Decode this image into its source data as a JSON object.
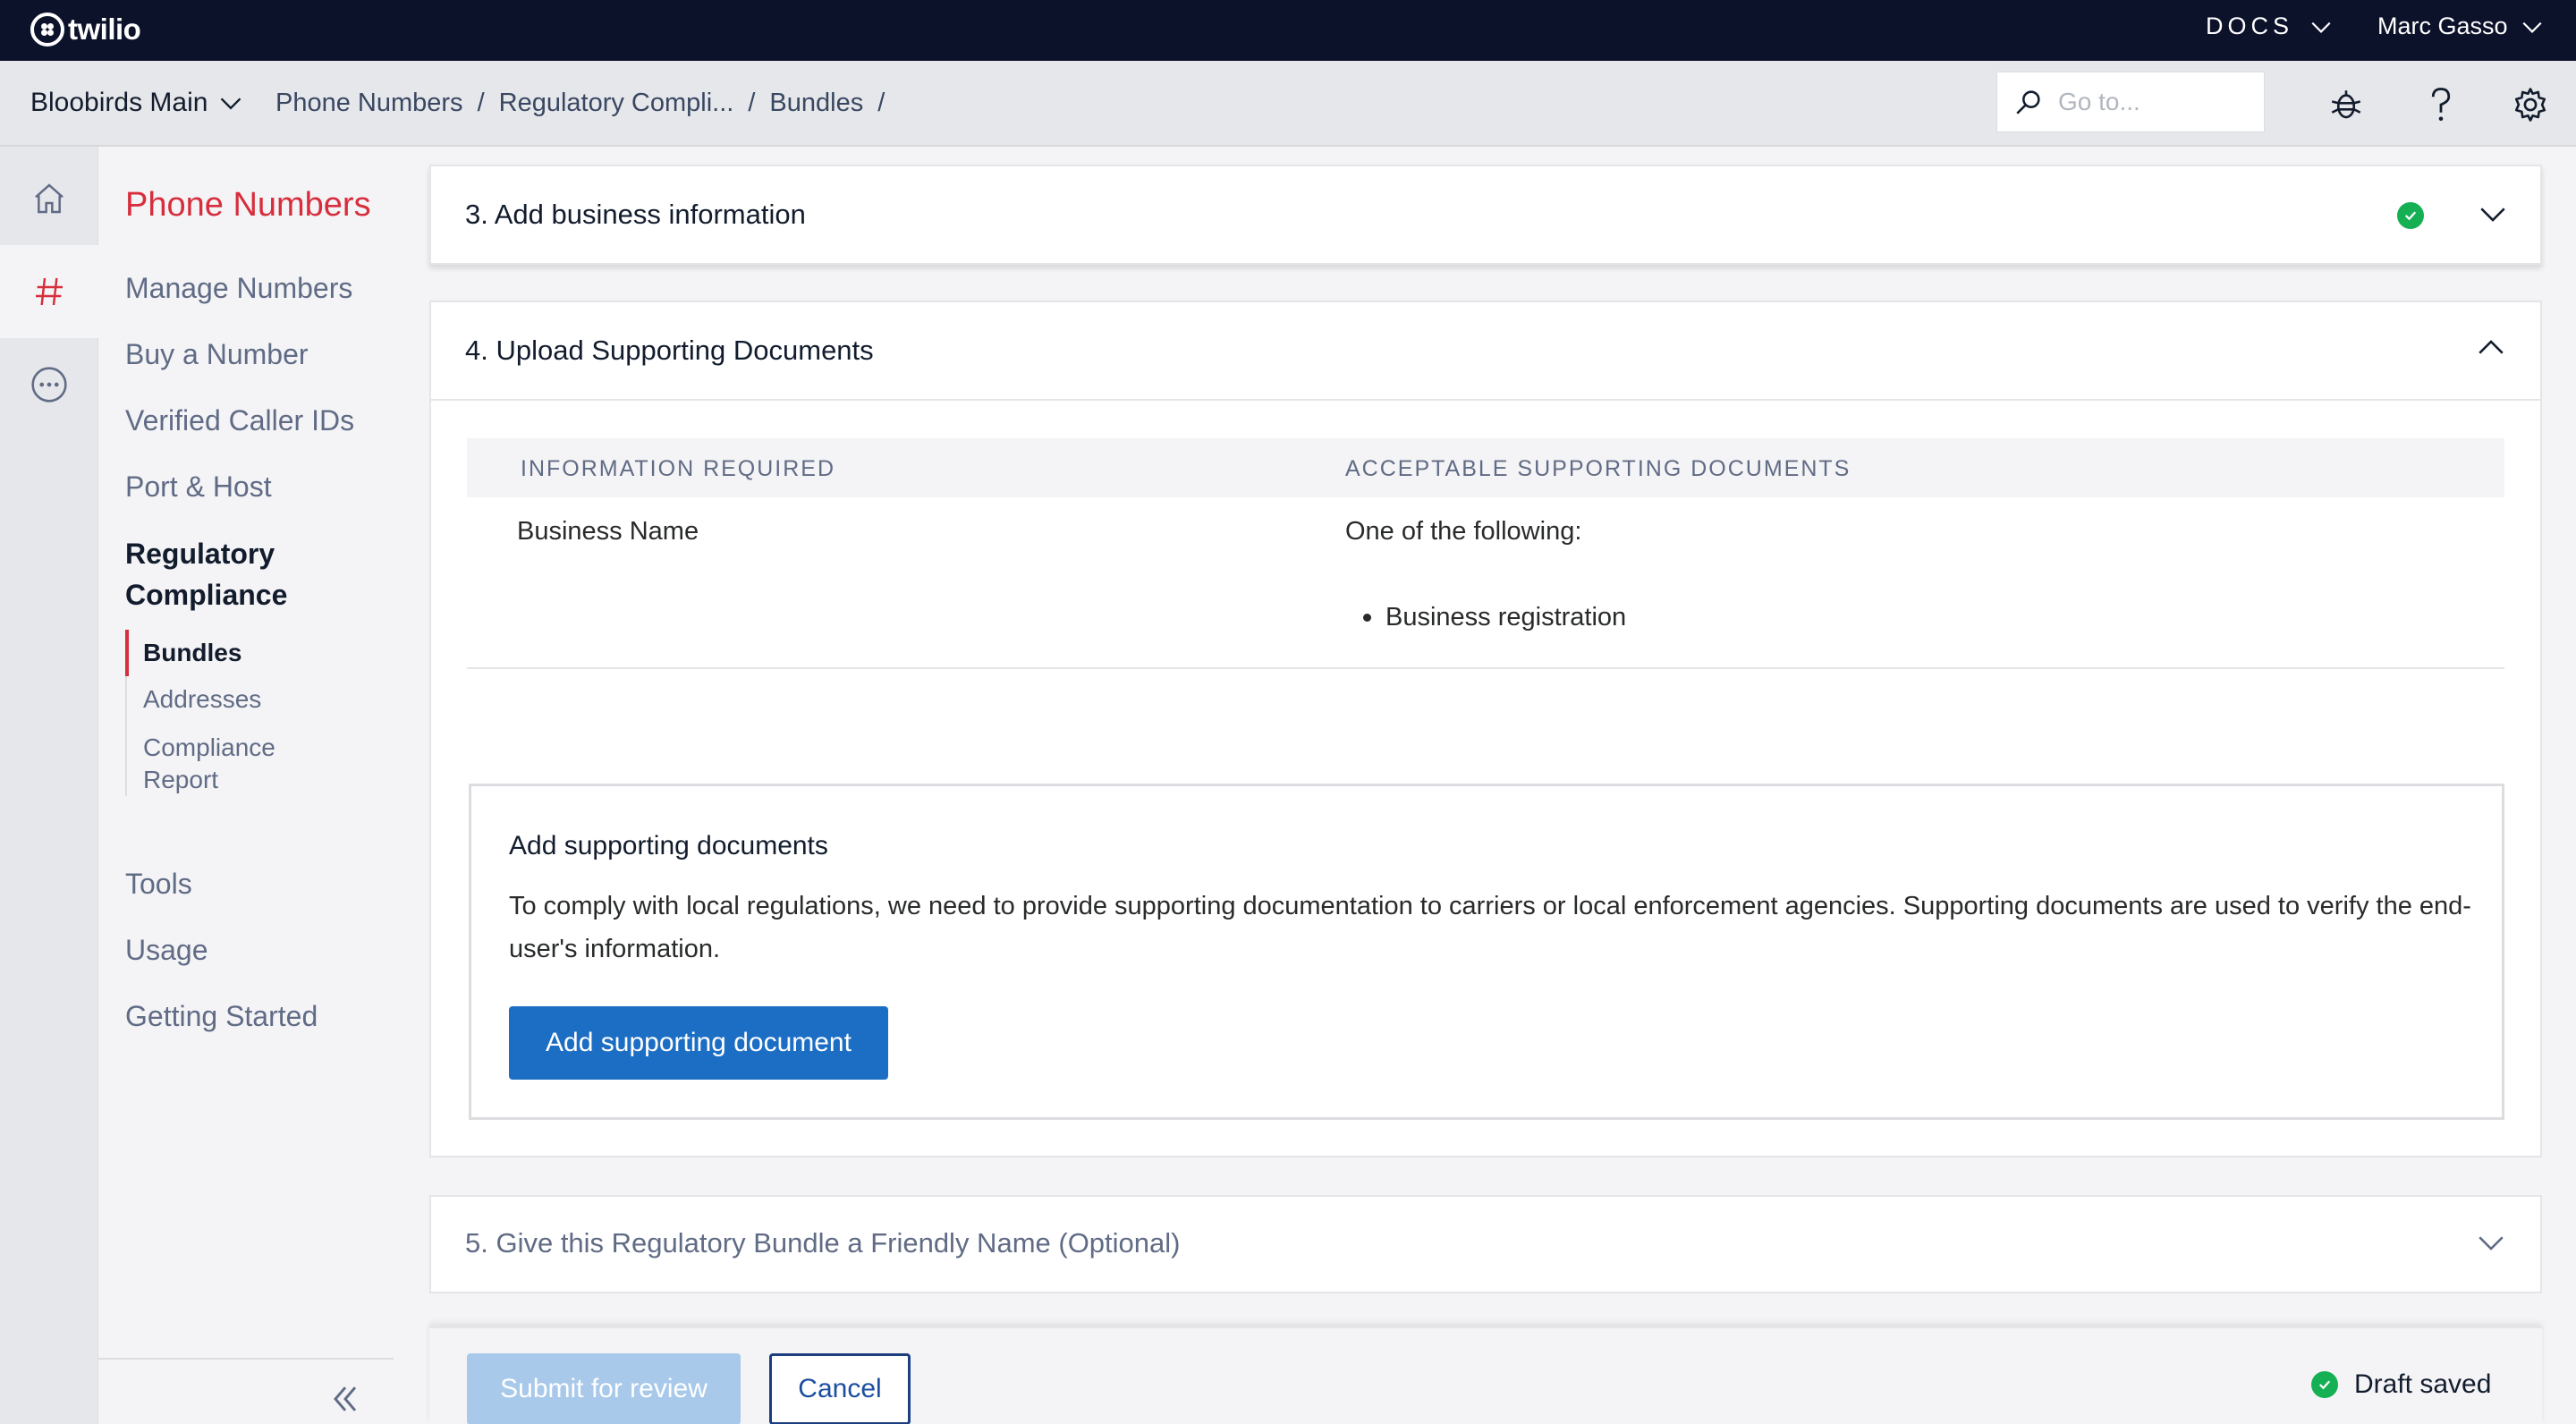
{
  "topbar": {
    "logo_text": "twilio",
    "docs_label": "DOCS",
    "user_name": "Marc Gasso"
  },
  "subbar": {
    "account_name": "Bloobirds Main",
    "breadcrumbs": [
      "Phone Numbers",
      "Regulatory Compli...",
      "Bundles"
    ],
    "breadcrumb_separator": "/",
    "search_placeholder": "Go to..."
  },
  "nav": {
    "title": "Phone Numbers",
    "items": [
      "Manage Numbers",
      "Buy a Number",
      "Verified Caller IDs",
      "Port & Host"
    ],
    "section_line1": "Regulatory",
    "section_line2": "Compliance",
    "subitems": [
      "Bundles",
      "Addresses",
      "Compliance",
      "Report"
    ],
    "bottom_items": [
      "Tools",
      "Usage",
      "Getting Started"
    ]
  },
  "steps": {
    "step3_title": "3. Add business information",
    "step4_title": "4. Upload Supporting Documents",
    "step5_title": "5. Give this Regulatory Bundle a Friendly Name (Optional)"
  },
  "table": {
    "col1_header": "INFORMATION REQUIRED",
    "col2_header": "ACCEPTABLE SUPPORTING DOCUMENTS",
    "row_info": "Business Name",
    "row_docs_intro": "One of the following:",
    "row_docs_item": "Business registration"
  },
  "support": {
    "title": "Add supporting documents",
    "text": "To comply with local regulations, we need to provide supporting documentation to carriers or local enforcement agencies. Supporting documents are used to verify the end-user's information.",
    "button_label": "Add supporting document"
  },
  "footer": {
    "submit_label": "Submit for review",
    "cancel_label": "Cancel",
    "status_text": "Draft saved"
  },
  "colors": {
    "topbar": "#0d122b",
    "accent_red": "#d72e3d",
    "primary_blue": "#1c6ec4",
    "success_green": "#14b053"
  }
}
